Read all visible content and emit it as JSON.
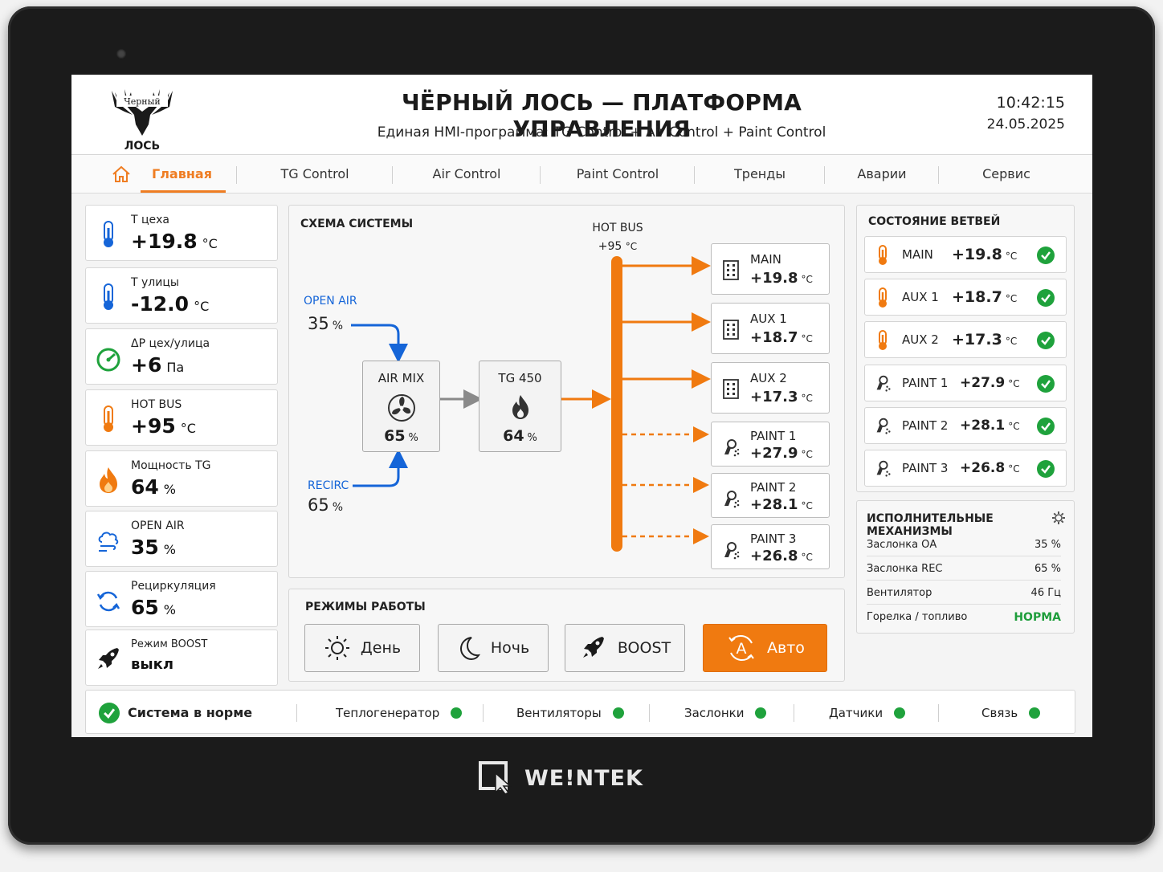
{
  "brand": "WE!NTEK",
  "header": {
    "logo_top": "Черный",
    "logo_bottom": "ЛОСЬ",
    "title": "ЧЁРНЫЙ ЛОСЬ — ПЛАТФОРМА УПРАВЛЕНИЯ",
    "subtitle": "Единая HMI-программа: TG Control + Air Control + Paint Control",
    "time": "10:42:15",
    "date": "24.05.2025"
  },
  "tabs": [
    {
      "label": "Главная",
      "icon": "home-icon",
      "active": true
    },
    {
      "label": "TG Control"
    },
    {
      "label": "Air Control"
    },
    {
      "label": "Paint Control"
    },
    {
      "label": "Тренды"
    },
    {
      "label": "Аварии"
    },
    {
      "label": "Сервис"
    }
  ],
  "left_cards": [
    {
      "label": "Т цеха",
      "value": "+19.8",
      "unit": "°C",
      "icon": "thermometer-blue-icon"
    },
    {
      "label": "Т улицы",
      "value": "-12.0",
      "unit": "°C",
      "icon": "thermometer-blue-icon"
    },
    {
      "label": "ΔР цех/улица",
      "value": "+6",
      "unit": "Па",
      "icon": "gauge-icon"
    },
    {
      "label": "HOT BUS",
      "value": "+95",
      "unit": "°C",
      "icon": "thermometer-orange-icon"
    },
    {
      "label": "Мощность TG",
      "value": "64",
      "unit": "%",
      "icon": "flame-icon"
    },
    {
      "label": "OPEN AIR",
      "value": "35",
      "unit": "%",
      "icon": "cloud-wind-icon"
    },
    {
      "label": "Рециркуляция",
      "value": "65",
      "unit": "%",
      "icon": "recirculation-icon"
    },
    {
      "label": "Режим BOOST",
      "value": "выкл",
      "unit": "",
      "icon": "rocket-icon"
    }
  ],
  "schema": {
    "title": "СХЕМА СИСТЕМЫ",
    "open_air": {
      "label": "OPEN AIR",
      "value": "35",
      "unit": "%"
    },
    "recirc": {
      "label": "RECIRC",
      "value": "65",
      "unit": "%"
    },
    "air_mix": {
      "label": "AIR MIX",
      "value": "65",
      "unit": "%"
    },
    "tg": {
      "label": "TG 450",
      "value": "64",
      "unit": "%"
    },
    "hot_bus": {
      "label": "HOT BUS",
      "value": "+95",
      "unit": "°C"
    },
    "destinations": [
      {
        "name": "MAIN",
        "value": "+19.8",
        "unit": "°C",
        "icon": "building-icon",
        "line": "solid"
      },
      {
        "name": "AUX 1",
        "value": "+18.7",
        "unit": "°C",
        "icon": "building-icon",
        "line": "solid"
      },
      {
        "name": "AUX 2",
        "value": "+17.3",
        "unit": "°C",
        "icon": "building-icon",
        "line": "solid"
      },
      {
        "name": "PAINT 1",
        "value": "+27.9",
        "unit": "°C",
        "icon": "spray-gun-icon",
        "line": "dashed"
      },
      {
        "name": "PAINT 2",
        "value": "+28.1",
        "unit": "°C",
        "icon": "spray-gun-icon",
        "line": "dashed"
      },
      {
        "name": "PAINT 3",
        "value": "+26.8",
        "unit": "°C",
        "icon": "spray-gun-icon",
        "line": "dashed"
      }
    ]
  },
  "modes": {
    "title": "РЕЖИМЫ РАБОТЫ",
    "items": [
      {
        "label": "День",
        "icon": "sun-icon",
        "active": false
      },
      {
        "label": "Ночь",
        "icon": "moon-icon",
        "active": false
      },
      {
        "label": "BOOST",
        "icon": "rocket-icon",
        "active": false
      },
      {
        "label": "Авто",
        "icon": "auto-icon",
        "active": true
      }
    ]
  },
  "branches": {
    "title": "СОСТОЯНИЕ ВЕТВЕЙ",
    "items": [
      {
        "name": "MAIN",
        "value": "+19.8",
        "unit": "°C",
        "icon": "thermometer-orange-icon",
        "status": "ok"
      },
      {
        "name": "AUX 1",
        "value": "+18.7",
        "unit": "°C",
        "icon": "thermometer-orange-icon",
        "status": "ok"
      },
      {
        "name": "AUX 2",
        "value": "+17.3",
        "unit": "°C",
        "icon": "thermometer-orange-icon",
        "status": "ok"
      },
      {
        "name": "PAINT 1",
        "value": "+27.9",
        "unit": "°C",
        "icon": "spray-gun-icon",
        "status": "ok"
      },
      {
        "name": "PAINT 2",
        "value": "+28.1",
        "unit": "°C",
        "icon": "spray-gun-icon",
        "status": "ok"
      },
      {
        "name": "PAINT 3",
        "value": "+26.8",
        "unit": "°C",
        "icon": "spray-gun-icon",
        "status": "ok"
      }
    ]
  },
  "actuators": {
    "title": "ИСПОЛНИТЕЛЬНЫЕ МЕХАНИЗМЫ",
    "items": [
      {
        "name": "Заслонка ОА",
        "value": "35 %"
      },
      {
        "name": "Заслонка REC",
        "value": "65 %"
      },
      {
        "name": "Вентилятор",
        "value": "46 Гц"
      },
      {
        "name": "Горелка / топливо",
        "value": "НОРМА"
      }
    ]
  },
  "status": {
    "main": "Система в норме",
    "items": [
      "Теплогенератор",
      "Вентиляторы",
      "Заслонки",
      "Датчики",
      "Связь"
    ]
  },
  "colors": {
    "accent": "#ef7d22",
    "ok": "#1fa23c",
    "air": "#1565d8",
    "hot": "#f07a10"
  }
}
